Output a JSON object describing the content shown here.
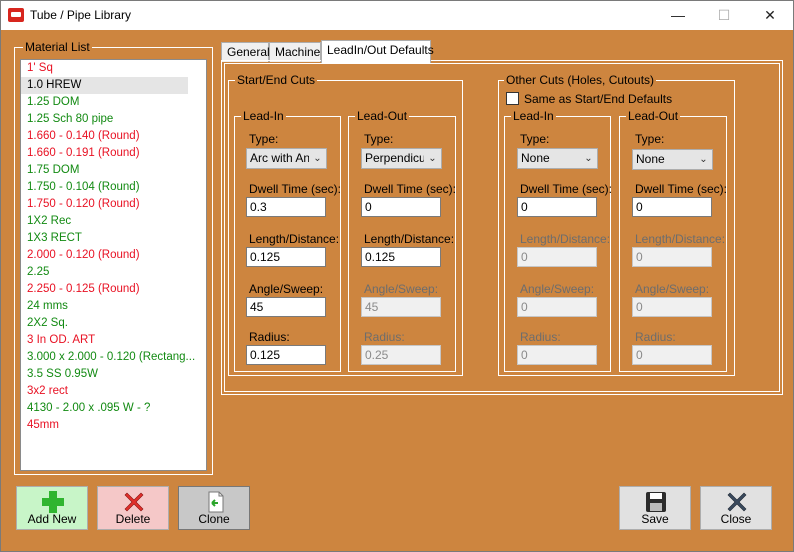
{
  "window": {
    "title": "Tube / Pipe Library"
  },
  "material_list": {
    "legend": "Material List",
    "items": [
      {
        "label": "1' Sq",
        "color": "red"
      },
      {
        "label": "1.0 HREW",
        "color": "black",
        "selected": true
      },
      {
        "label": "1.25 DOM",
        "color": "green"
      },
      {
        "label": "1.25 Sch 80 pipe",
        "color": "green"
      },
      {
        "label": "1.660 - 0.140 (Round)",
        "color": "red"
      },
      {
        "label": "1.660 - 0.191 (Round)",
        "color": "red"
      },
      {
        "label": "1.75 DOM",
        "color": "green"
      },
      {
        "label": "1.750 - 0.104 (Round)",
        "color": "green"
      },
      {
        "label": "1.750 - 0.120 (Round)",
        "color": "red"
      },
      {
        "label": "1X2 Rec",
        "color": "green"
      },
      {
        "label": "1X3 RECT",
        "color": "green"
      },
      {
        "label": "2.000 - 0.120 (Round)",
        "color": "red"
      },
      {
        "label": "2.25",
        "color": "green"
      },
      {
        "label": "2.250 - 0.125 (Round)",
        "color": "red"
      },
      {
        "label": "24 mms",
        "color": "green"
      },
      {
        "label": "2X2 Sq.",
        "color": "green"
      },
      {
        "label": "3 In OD. ART",
        "color": "red"
      },
      {
        "label": "3.000 x 2.000 - 0.120 (Rectang...",
        "color": "green"
      },
      {
        "label": "3.5 SS 0.95W",
        "color": "green"
      },
      {
        "label": "3x2 rect",
        "color": "red"
      },
      {
        "label": "4130 - 2.00 x .095  W - ?",
        "color": "green"
      },
      {
        "label": "45mm",
        "color": "red"
      }
    ]
  },
  "tabs": [
    {
      "label": "General"
    },
    {
      "label": "Machine"
    },
    {
      "label": "LeadIn/Out Defaults",
      "active": true
    }
  ],
  "start_end": {
    "legend": "Start/End Cuts",
    "lead_in": {
      "legend": "Lead-In",
      "type_label": "Type:",
      "type_value": "Arc with Ang",
      "dwell_label": "Dwell Time (sec):",
      "dwell_value": "0.3",
      "length_label": "Length/Distance:",
      "length_value": "0.125",
      "angle_label": "Angle/Sweep:",
      "angle_value": "45",
      "radius_label": "Radius:",
      "radius_value": "0.125"
    },
    "lead_out": {
      "legend": "Lead-Out",
      "type_label": "Type:",
      "type_value": "Perpendicul",
      "dwell_label": "Dwell Time (sec):",
      "dwell_value": "0",
      "length_label": "Length/Distance:",
      "length_value": "0.125",
      "angle_label": "Angle/Sweep:",
      "angle_value": "45",
      "radius_label": "Radius:",
      "radius_value": "0.25"
    }
  },
  "other_cuts": {
    "legend": "Other Cuts (Holes, Cutouts)",
    "same_as_label": "Same as Start/End Defaults",
    "lead_in": {
      "legend": "Lead-In",
      "type_label": "Type:",
      "type_value": "None",
      "dwell_label": "Dwell Time (sec):",
      "dwell_value": "0",
      "length_label": "Length/Distance:",
      "length_value": "0",
      "angle_label": "Angle/Sweep:",
      "angle_value": "0",
      "radius_label": "Radius:",
      "radius_value": "0"
    },
    "lead_out": {
      "legend": "Lead-Out",
      "type_label": "Type:",
      "type_value": "None",
      "dwell_label": "Dwell Time (sec):",
      "dwell_value": "0",
      "length_label": "Length/Distance:",
      "length_value": "0",
      "angle_label": "Angle/Sweep:",
      "angle_value": "0",
      "radius_label": "Radius:",
      "radius_value": "0"
    }
  },
  "buttons": {
    "add_new": "Add New",
    "delete": "Delete",
    "clone": "Clone",
    "save": "Save",
    "close": "Close"
  },
  "colors": {
    "background": "#cd853f",
    "list_red": "#e81123",
    "list_green": "#128a12",
    "add_button": "#c8f5c8",
    "delete_button": "#f5c8c8"
  }
}
